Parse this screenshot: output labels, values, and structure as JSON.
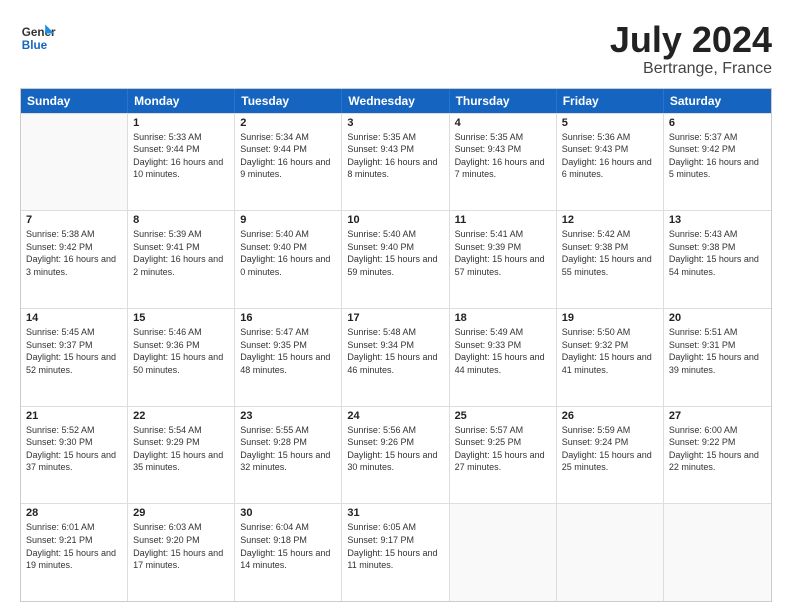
{
  "header": {
    "logo_line1": "General",
    "logo_line2": "Blue",
    "month": "July 2024",
    "location": "Bertrange, France"
  },
  "days_of_week": [
    "Sunday",
    "Monday",
    "Tuesday",
    "Wednesday",
    "Thursday",
    "Friday",
    "Saturday"
  ],
  "weeks": [
    [
      {
        "day": null,
        "sunrise": null,
        "sunset": null,
        "daylight": null
      },
      {
        "day": "1",
        "sunrise": "Sunrise: 5:33 AM",
        "sunset": "Sunset: 9:44 PM",
        "daylight": "Daylight: 16 hours and 10 minutes."
      },
      {
        "day": "2",
        "sunrise": "Sunrise: 5:34 AM",
        "sunset": "Sunset: 9:44 PM",
        "daylight": "Daylight: 16 hours and 9 minutes."
      },
      {
        "day": "3",
        "sunrise": "Sunrise: 5:35 AM",
        "sunset": "Sunset: 9:43 PM",
        "daylight": "Daylight: 16 hours and 8 minutes."
      },
      {
        "day": "4",
        "sunrise": "Sunrise: 5:35 AM",
        "sunset": "Sunset: 9:43 PM",
        "daylight": "Daylight: 16 hours and 7 minutes."
      },
      {
        "day": "5",
        "sunrise": "Sunrise: 5:36 AM",
        "sunset": "Sunset: 9:43 PM",
        "daylight": "Daylight: 16 hours and 6 minutes."
      },
      {
        "day": "6",
        "sunrise": "Sunrise: 5:37 AM",
        "sunset": "Sunset: 9:42 PM",
        "daylight": "Daylight: 16 hours and 5 minutes."
      }
    ],
    [
      {
        "day": "7",
        "sunrise": "Sunrise: 5:38 AM",
        "sunset": "Sunset: 9:42 PM",
        "daylight": "Daylight: 16 hours and 3 minutes."
      },
      {
        "day": "8",
        "sunrise": "Sunrise: 5:39 AM",
        "sunset": "Sunset: 9:41 PM",
        "daylight": "Daylight: 16 hours and 2 minutes."
      },
      {
        "day": "9",
        "sunrise": "Sunrise: 5:40 AM",
        "sunset": "Sunset: 9:40 PM",
        "daylight": "Daylight: 16 hours and 0 minutes."
      },
      {
        "day": "10",
        "sunrise": "Sunrise: 5:40 AM",
        "sunset": "Sunset: 9:40 PM",
        "daylight": "Daylight: 15 hours and 59 minutes."
      },
      {
        "day": "11",
        "sunrise": "Sunrise: 5:41 AM",
        "sunset": "Sunset: 9:39 PM",
        "daylight": "Daylight: 15 hours and 57 minutes."
      },
      {
        "day": "12",
        "sunrise": "Sunrise: 5:42 AM",
        "sunset": "Sunset: 9:38 PM",
        "daylight": "Daylight: 15 hours and 55 minutes."
      },
      {
        "day": "13",
        "sunrise": "Sunrise: 5:43 AM",
        "sunset": "Sunset: 9:38 PM",
        "daylight": "Daylight: 15 hours and 54 minutes."
      }
    ],
    [
      {
        "day": "14",
        "sunrise": "Sunrise: 5:45 AM",
        "sunset": "Sunset: 9:37 PM",
        "daylight": "Daylight: 15 hours and 52 minutes."
      },
      {
        "day": "15",
        "sunrise": "Sunrise: 5:46 AM",
        "sunset": "Sunset: 9:36 PM",
        "daylight": "Daylight: 15 hours and 50 minutes."
      },
      {
        "day": "16",
        "sunrise": "Sunrise: 5:47 AM",
        "sunset": "Sunset: 9:35 PM",
        "daylight": "Daylight: 15 hours and 48 minutes."
      },
      {
        "day": "17",
        "sunrise": "Sunrise: 5:48 AM",
        "sunset": "Sunset: 9:34 PM",
        "daylight": "Daylight: 15 hours and 46 minutes."
      },
      {
        "day": "18",
        "sunrise": "Sunrise: 5:49 AM",
        "sunset": "Sunset: 9:33 PM",
        "daylight": "Daylight: 15 hours and 44 minutes."
      },
      {
        "day": "19",
        "sunrise": "Sunrise: 5:50 AM",
        "sunset": "Sunset: 9:32 PM",
        "daylight": "Daylight: 15 hours and 41 minutes."
      },
      {
        "day": "20",
        "sunrise": "Sunrise: 5:51 AM",
        "sunset": "Sunset: 9:31 PM",
        "daylight": "Daylight: 15 hours and 39 minutes."
      }
    ],
    [
      {
        "day": "21",
        "sunrise": "Sunrise: 5:52 AM",
        "sunset": "Sunset: 9:30 PM",
        "daylight": "Daylight: 15 hours and 37 minutes."
      },
      {
        "day": "22",
        "sunrise": "Sunrise: 5:54 AM",
        "sunset": "Sunset: 9:29 PM",
        "daylight": "Daylight: 15 hours and 35 minutes."
      },
      {
        "day": "23",
        "sunrise": "Sunrise: 5:55 AM",
        "sunset": "Sunset: 9:28 PM",
        "daylight": "Daylight: 15 hours and 32 minutes."
      },
      {
        "day": "24",
        "sunrise": "Sunrise: 5:56 AM",
        "sunset": "Sunset: 9:26 PM",
        "daylight": "Daylight: 15 hours and 30 minutes."
      },
      {
        "day": "25",
        "sunrise": "Sunrise: 5:57 AM",
        "sunset": "Sunset: 9:25 PM",
        "daylight": "Daylight: 15 hours and 27 minutes."
      },
      {
        "day": "26",
        "sunrise": "Sunrise: 5:59 AM",
        "sunset": "Sunset: 9:24 PM",
        "daylight": "Daylight: 15 hours and 25 minutes."
      },
      {
        "day": "27",
        "sunrise": "Sunrise: 6:00 AM",
        "sunset": "Sunset: 9:22 PM",
        "daylight": "Daylight: 15 hours and 22 minutes."
      }
    ],
    [
      {
        "day": "28",
        "sunrise": "Sunrise: 6:01 AM",
        "sunset": "Sunset: 9:21 PM",
        "daylight": "Daylight: 15 hours and 19 minutes."
      },
      {
        "day": "29",
        "sunrise": "Sunrise: 6:03 AM",
        "sunset": "Sunset: 9:20 PM",
        "daylight": "Daylight: 15 hours and 17 minutes."
      },
      {
        "day": "30",
        "sunrise": "Sunrise: 6:04 AM",
        "sunset": "Sunset: 9:18 PM",
        "daylight": "Daylight: 15 hours and 14 minutes."
      },
      {
        "day": "31",
        "sunrise": "Sunrise: 6:05 AM",
        "sunset": "Sunset: 9:17 PM",
        "daylight": "Daylight: 15 hours and 11 minutes."
      },
      {
        "day": null,
        "sunrise": null,
        "sunset": null,
        "daylight": null
      },
      {
        "day": null,
        "sunrise": null,
        "sunset": null,
        "daylight": null
      },
      {
        "day": null,
        "sunrise": null,
        "sunset": null,
        "daylight": null
      }
    ]
  ]
}
